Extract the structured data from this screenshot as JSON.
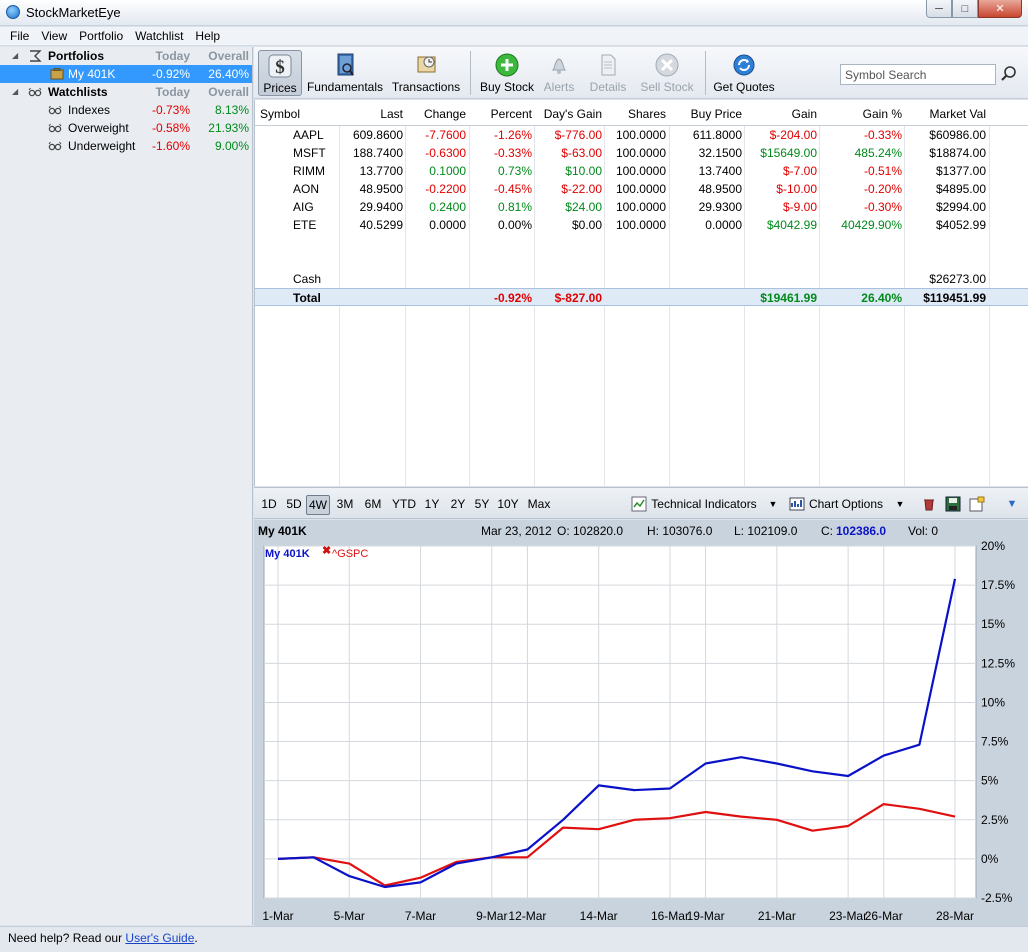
{
  "window": {
    "title": "StockMarketEye",
    "min": "─",
    "max": "□",
    "close": "✕"
  },
  "menu": [
    "File",
    "View",
    "Portfolio",
    "Watchlist",
    "Help"
  ],
  "tree": {
    "portfolios": {
      "label": "Portfolios",
      "today_hdr": "Today",
      "overall_hdr": "Overall",
      "items": [
        {
          "label": "My 401K",
          "today": "-0.92%",
          "overall": "26.40%"
        }
      ]
    },
    "watchlists": {
      "label": "Watchlists",
      "today_hdr": "Today",
      "overall_hdr": "Overall",
      "items": [
        {
          "label": "Indexes",
          "today": "-0.73%",
          "overall": "8.13%"
        },
        {
          "label": "Overweight",
          "today": "-0.58%",
          "overall": "21.93%"
        },
        {
          "label": "Underweight",
          "today": "-1.60%",
          "overall": "9.00%"
        }
      ]
    }
  },
  "toolbar": {
    "prices": "Prices",
    "fundamentals": "Fundamentals",
    "transactions": "Transactions",
    "buy_stock": "Buy Stock",
    "alerts": "Alerts",
    "details": "Details",
    "sell_stock": "Sell Stock",
    "get_quotes": "Get Quotes",
    "search_placeholder": "Symbol Search"
  },
  "grid": {
    "columns": [
      "Symbol",
      "Last",
      "Change",
      "Percent",
      "Day's Gain",
      "Shares",
      "Buy Price",
      "Gain",
      "Gain %",
      "Market Val"
    ],
    "rows": [
      [
        "AAPL",
        "609.8600",
        "-7.7600",
        "-1.26%",
        "$-776.00",
        "100.0000",
        "611.8000",
        "$-204.00",
        "-0.33%",
        "$60986.00"
      ],
      [
        "MSFT",
        "188.7400",
        "-0.6300",
        "-0.33%",
        "$-63.00",
        "100.0000",
        "32.1500",
        "$15649.00",
        "485.24%",
        "$18874.00"
      ],
      [
        "RIMM",
        "13.7700",
        "0.1000",
        "0.73%",
        "$10.00",
        "100.0000",
        "13.7400",
        "$-7.00",
        "-0.51%",
        "$1377.00"
      ],
      [
        "AON",
        "48.9500",
        "-0.2200",
        "-0.45%",
        "$-22.00",
        "100.0000",
        "48.9500",
        "$-10.00",
        "-0.20%",
        "$4895.00"
      ],
      [
        "AIG",
        "29.9400",
        "0.2400",
        "0.81%",
        "$24.00",
        "100.0000",
        "29.9300",
        "$-9.00",
        "-0.30%",
        "$2994.00"
      ],
      [
        "ETE",
        "40.5299",
        "0.0000",
        "0.00%",
        "$0.00",
        "100.0000",
        "0.0000",
        "$4042.99",
        "40429.90%",
        "$4052.99"
      ]
    ],
    "cash": {
      "label": "Cash",
      "market_val": "$26273.00"
    },
    "total": {
      "label": "Total",
      "percent": "-0.92%",
      "days_gain": "$-827.00",
      "gain": "$19461.99",
      "gain_pct": "26.40%",
      "market_val": "$119451.99"
    }
  },
  "ranges": [
    "1D",
    "5D",
    "4W",
    "3M",
    "6M",
    "YTD",
    "1Y",
    "2Y",
    "5Y",
    "10Y",
    "Max"
  ],
  "active_range": "4W",
  "chart_controls": {
    "technical_indicators": "Technical Indicators",
    "chart_options": "Chart Options"
  },
  "chart_info": {
    "name": "My 401K",
    "date": "Mar 23, 2012",
    "open": "O: 102820.0",
    "high": "H: 103076.0",
    "low": "L: 102109.0",
    "close_label": "C:",
    "close_value": "102386.0",
    "vol": "Vol: 0"
  },
  "colors": {
    "portfolio_line": "#0a12c8",
    "index_line": "#e01010",
    "negative": "#e00000",
    "positive": "#008a1a"
  },
  "chart_data": {
    "type": "line",
    "ylim": [
      -2.5,
      20
    ],
    "y_ticks": [
      "-2.5%",
      "0%",
      "2.5%",
      "5%",
      "7.5%",
      "10%",
      "12.5%",
      "15%",
      "17.5%",
      "20%"
    ],
    "x_labels": [
      "1-Mar",
      "5-Mar",
      "7-Mar",
      "9-Mar",
      "12-Mar",
      "14-Mar",
      "16-Mar",
      "19-Mar",
      "21-Mar",
      "23-Mar",
      "26-Mar",
      "28-Mar"
    ],
    "dates": [
      "1-Mar",
      "2-Mar",
      "5-Mar",
      "6-Mar",
      "7-Mar",
      "8-Mar",
      "9-Mar",
      "12-Mar",
      "13-Mar",
      "14-Mar",
      "15-Mar",
      "16-Mar",
      "19-Mar",
      "20-Mar",
      "21-Mar",
      "22-Mar",
      "23-Mar",
      "26-Mar",
      "27-Mar",
      "28-Mar"
    ],
    "series": [
      {
        "name": "My 401K",
        "values": [
          0.0,
          0.1,
          -1.1,
          -1.8,
          -1.5,
          -0.3,
          0.1,
          0.6,
          2.5,
          4.7,
          4.4,
          4.5,
          6.1,
          6.5,
          6.1,
          5.6,
          5.3,
          6.6,
          7.3,
          17.9
        ]
      },
      {
        "name": "^GSPC",
        "values": [
          0.0,
          0.1,
          -0.3,
          -1.7,
          -1.2,
          -0.2,
          0.1,
          0.1,
          2.0,
          1.9,
          2.5,
          2.6,
          3.0,
          2.7,
          2.5,
          1.8,
          2.1,
          3.5,
          3.2,
          2.7
        ]
      }
    ]
  },
  "status": {
    "text": "Need help? Read our ",
    "link": "User's Guide",
    "suffix": "."
  }
}
